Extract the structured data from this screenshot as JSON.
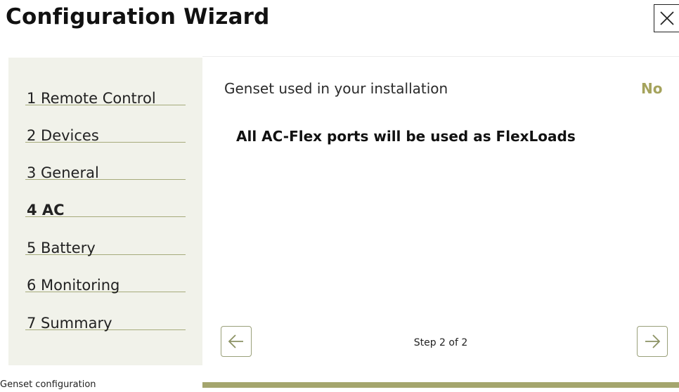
{
  "header": {
    "title": "Configuration Wizard",
    "close_icon": "close-icon"
  },
  "sidebar": {
    "active_index": 3,
    "items": [
      {
        "label": "1 Remote Control"
      },
      {
        "label": "2 Devices"
      },
      {
        "label": "3 General"
      },
      {
        "label": "4 AC"
      },
      {
        "label": "5 Battery"
      },
      {
        "label": "6 Monitoring"
      },
      {
        "label": "7 Summary"
      }
    ]
  },
  "main": {
    "setting_label": "Genset used in your installation",
    "setting_value": "No",
    "info_text": "All AC-Flex ports will be used as FlexLoads",
    "step_counter": "Step 2 of 2",
    "prev_icon": "arrow-left-icon",
    "next_icon": "arrow-right-icon"
  },
  "footer": {
    "label": "Genset configuration",
    "progress": 1.0
  },
  "colors": {
    "accent": "#a5a35c",
    "sidebar_bg": "#f1f2ea",
    "divider": "#a6ab7b"
  }
}
